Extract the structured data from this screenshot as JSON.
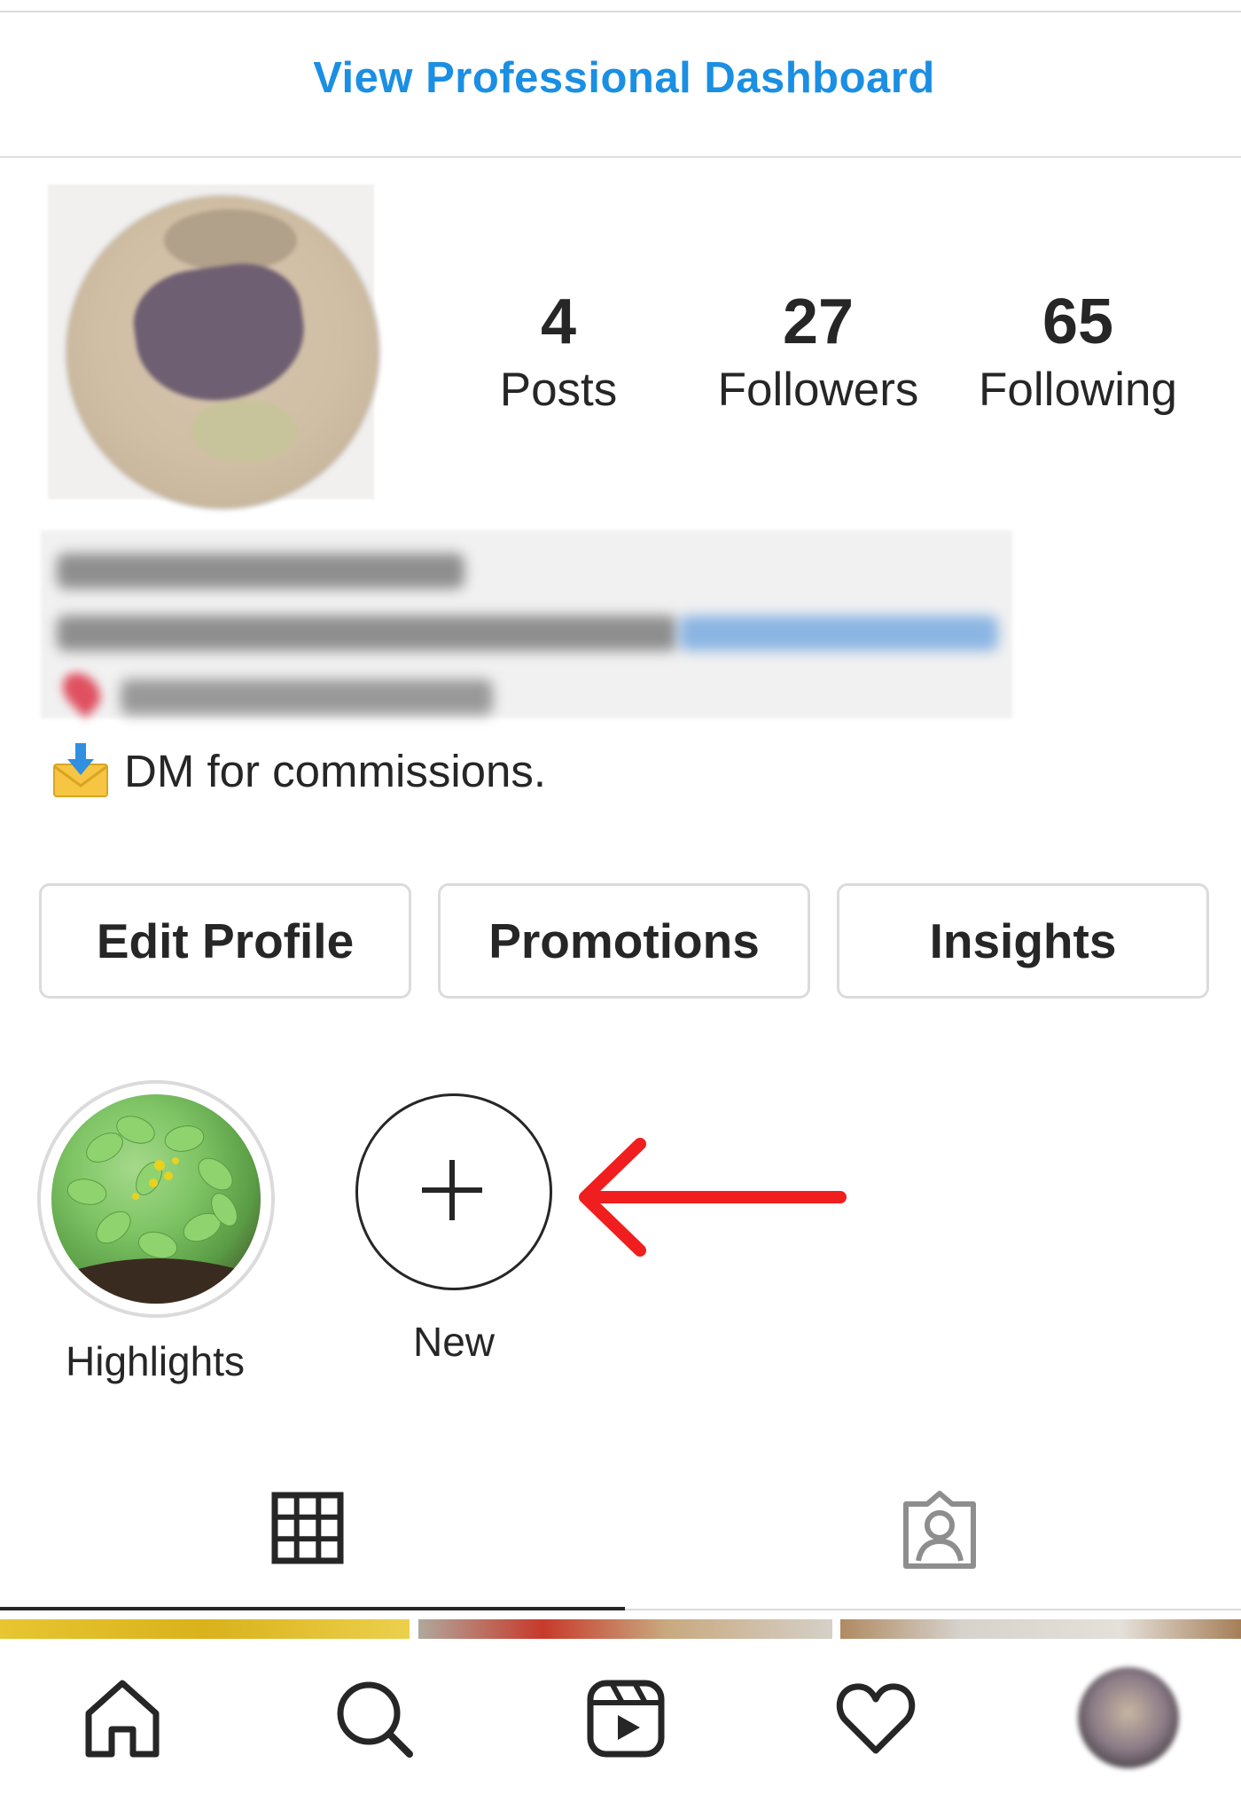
{
  "header": {
    "professional_dashboard_link": "View Professional Dashboard"
  },
  "profile": {
    "stats": [
      {
        "value": "4",
        "label": "Posts"
      },
      {
        "value": "27",
        "label": "Followers"
      },
      {
        "value": "65",
        "label": "Following"
      }
    ],
    "bio_visible_line": "DM for commissions."
  },
  "actions": {
    "edit_profile": "Edit Profile",
    "promotions": "Promotions",
    "insights": "Insights"
  },
  "highlights": [
    {
      "label": "Highlights"
    },
    {
      "label": "New"
    }
  ],
  "tabs": [
    {
      "icon": "grid-icon",
      "active": true
    },
    {
      "icon": "tagged-person-icon",
      "active": false
    }
  ],
  "bottom_nav": [
    "home-icon",
    "search-icon",
    "reels-icon",
    "heart-icon",
    "profile-avatar"
  ],
  "colors": {
    "link_blue": "#1a8fe3",
    "annotation_red": "#f01e1e",
    "text": "#262626",
    "border": "#dbdbdb"
  }
}
